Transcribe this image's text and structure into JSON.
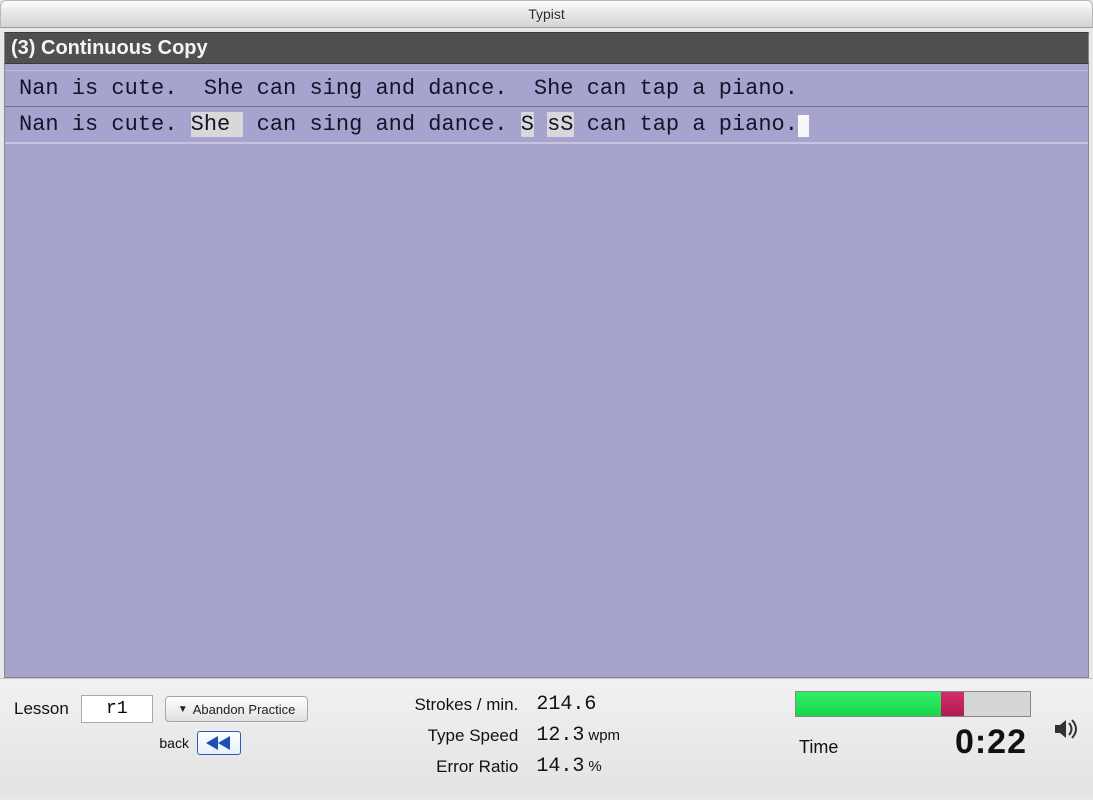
{
  "titlebar": {
    "title": "Typist"
  },
  "header": {
    "title": "(3) Continuous Copy"
  },
  "typing": {
    "target_line": "Nan is cute.  She can sing and dance.  She can tap a piano.",
    "typed_segments": [
      {
        "text": "Nan is cute. ",
        "error": false
      },
      {
        "text": "She ",
        "error": true
      },
      {
        "text": " can sing and dance. ",
        "error": false
      },
      {
        "text": "S",
        "error": true
      },
      {
        "text": " ",
        "error": false
      },
      {
        "text": "sS",
        "error": true
      },
      {
        "text": " can tap a piano.",
        "error": false
      }
    ]
  },
  "status": {
    "lesson_label": "Lesson",
    "lesson_value": "r1",
    "abandon_label": "Abandon Practice",
    "back_label": "back",
    "stats": {
      "strokes_label": "Strokes / min.",
      "strokes_value": "214.6",
      "speed_label": "Type Speed",
      "speed_value": "12.3",
      "speed_unit": "wpm",
      "error_label": "Error Ratio",
      "error_value": "14.3",
      "error_unit": "%"
    },
    "time_label": "Time",
    "time_value": "0:22",
    "progress": {
      "green_pct": 62,
      "red_pct": 10
    }
  }
}
